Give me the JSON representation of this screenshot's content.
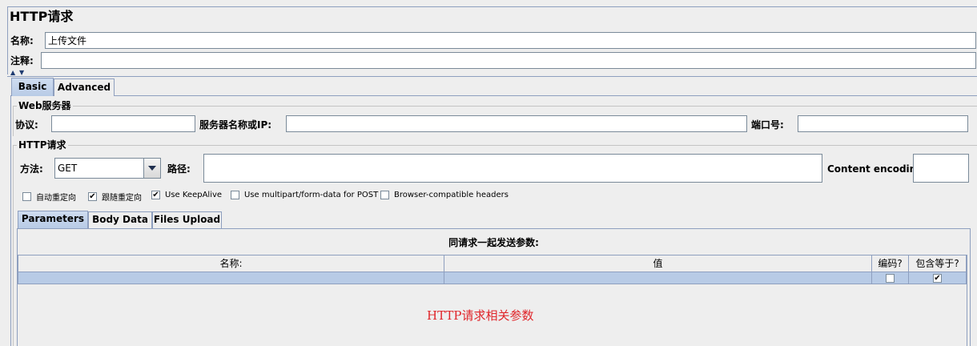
{
  "header": {
    "title": "HTTP请求",
    "name_label": "名称:",
    "name_value": "上传文件",
    "comment_label": "注释:",
    "comment_value": ""
  },
  "tabs": [
    {
      "label": "Basic",
      "active": true
    },
    {
      "label": "Advanced",
      "active": false
    }
  ],
  "web_server": {
    "group_title": "Web服务器",
    "protocol_label": "协议:",
    "protocol_value": "",
    "server_label": "服务器名称或IP:",
    "server_value": "",
    "port_label": "端口号:",
    "port_value": ""
  },
  "http_request": {
    "group_title": "HTTP请求",
    "method_label": "方法:",
    "method_value": "GET",
    "path_label": "路径:",
    "path_value": "",
    "encoding_label": "Content encoding:",
    "encoding_value": ""
  },
  "checkboxes": [
    {
      "label": "自动重定向",
      "checked": false
    },
    {
      "label": "跟随重定向",
      "checked": true
    },
    {
      "label": "Use KeepAlive",
      "checked": true
    },
    {
      "label": "Use multipart/form-data for POST",
      "checked": false
    },
    {
      "label": "Browser-compatible headers",
      "checked": false
    }
  ],
  "sub_tabs": [
    {
      "label": "Parameters",
      "active": true
    },
    {
      "label": "Body Data",
      "active": false
    },
    {
      "label": "Files Upload",
      "active": false
    }
  ],
  "params_table": {
    "caption": "同请求一起发送参数:",
    "columns": [
      "名称:",
      "值",
      "编码?",
      "包含等于?"
    ],
    "rows": [
      {
        "name": "",
        "value": "",
        "encode": false,
        "include_equals": true
      }
    ]
  },
  "annotation": {
    "text": "HTTP请求相关参数",
    "color": "#e0252a"
  },
  "colors": {
    "border": "#8e9fbf",
    "selected_row": "#b8cbe6",
    "background": "#eeeeee"
  }
}
